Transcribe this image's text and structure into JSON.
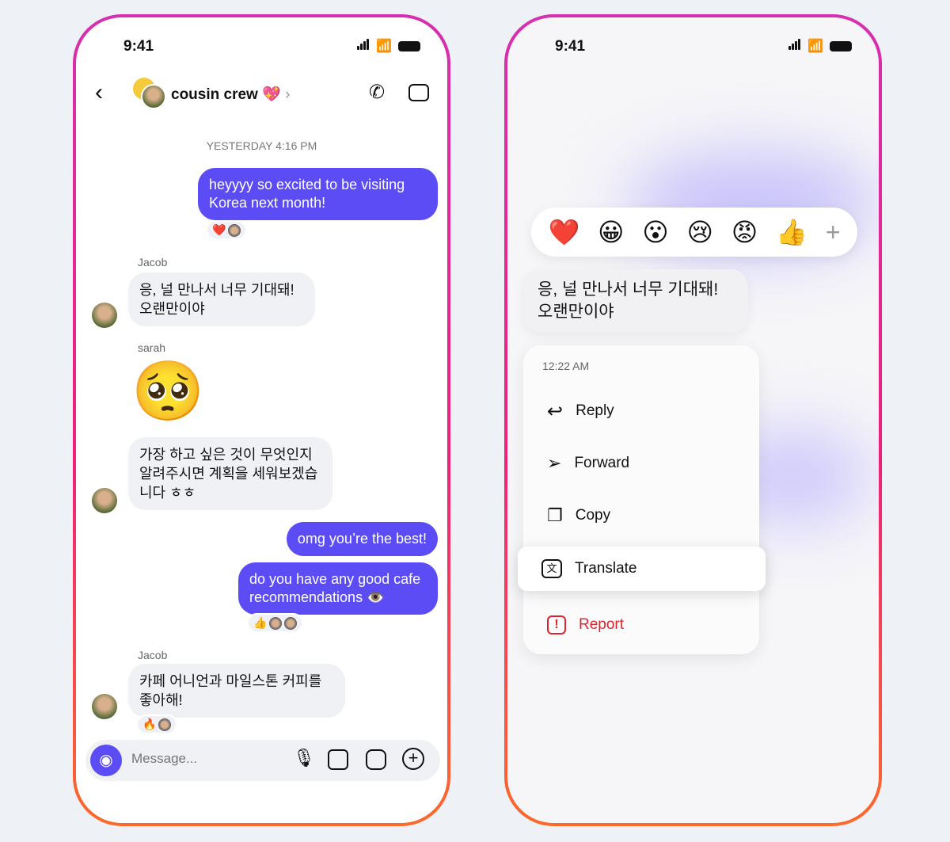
{
  "status": {
    "time": "9:41"
  },
  "chat": {
    "header": {
      "title": "cousin crew",
      "title_emoji": "💖"
    },
    "timestamp": "YESTERDAY 4:16 PM",
    "messages": [
      {
        "text": "heyyyy so excited to be visiting Korea next month!",
        "reactions": "❤️"
      },
      {
        "sender": "Jacob",
        "text": "응, 널 만나서 너무 기대돼! 오랜만이야"
      },
      {
        "sender": "sarah",
        "sticker": "🥺"
      },
      {
        "text": "가장 하고 싶은 것이 무엇인지 알려주시면 계획을 세워보겠습니다 ㅎㅎ"
      },
      {
        "text": "omg you’re the best!"
      },
      {
        "text": "do you have any good cafe recommendations 👁️",
        "reactions": "👍"
      },
      {
        "sender": "Jacob",
        "text": "카페 어니언과 마일스톤 커피를 좋아해!",
        "reactions": "🔥"
      }
    ],
    "composer": {
      "placeholder": "Message..."
    }
  },
  "context": {
    "reactions": [
      "❤️",
      "😀",
      "😮",
      "😢",
      "😡",
      "👍",
      "+"
    ],
    "message": "응, 널 만나서 너무 기대돼! 오랜만이야",
    "time": "12:22 AM",
    "menu": [
      {
        "label": "Reply"
      },
      {
        "label": "Forward"
      },
      {
        "label": "Copy"
      },
      {
        "label": "Translate"
      },
      {
        "label": "Report"
      }
    ],
    "report_color": "#e0222e"
  },
  "colors": {
    "accent": "#5b4cf5"
  }
}
